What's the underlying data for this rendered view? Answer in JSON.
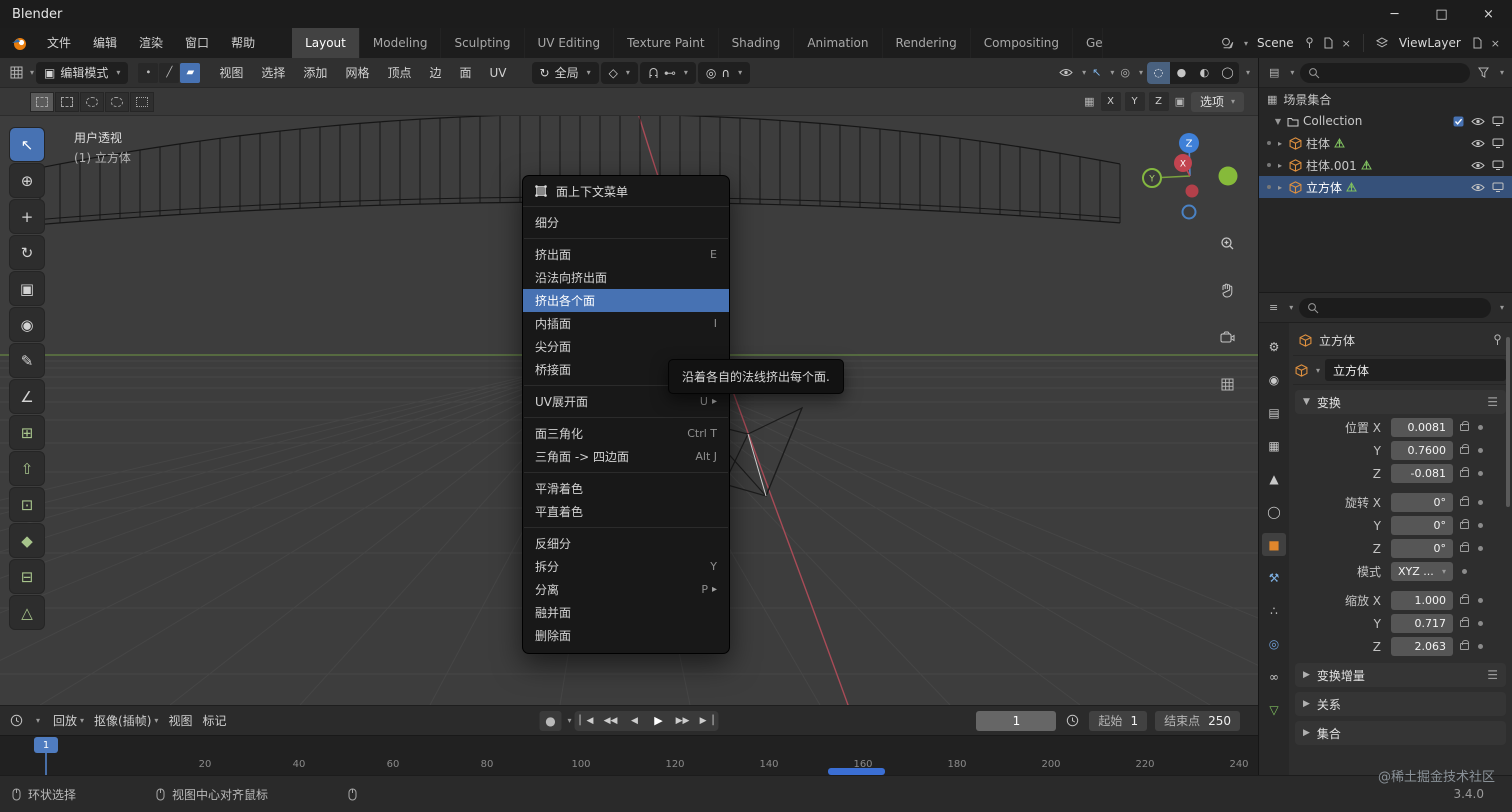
{
  "titlebar": {
    "app_title": "Blender"
  },
  "menubar": {
    "menus": [
      "文件",
      "编辑",
      "渲染",
      "窗口",
      "帮助"
    ],
    "workspaces": [
      "Layout",
      "Modeling",
      "Sculpting",
      "UV Editing",
      "Texture Paint",
      "Shading",
      "Animation",
      "Rendering",
      "Compositing",
      "Ge"
    ],
    "active_workspace": "Layout",
    "scene_name": "Scene",
    "viewlayer_name": "ViewLayer"
  },
  "header": {
    "mode_select": "编辑模式",
    "menus": [
      "视图",
      "选择",
      "添加",
      "网格",
      "顶点",
      "边",
      "面",
      "UV"
    ],
    "orientation": "全局",
    "mirror_axes": [
      "X",
      "Y",
      "Z"
    ],
    "options_label": "选项"
  },
  "viewport": {
    "view_name": "用户透视",
    "active_object": "(1) 立方体",
    "gizmo_axes": [
      "X",
      "Y",
      "Z"
    ],
    "nav_buttons": [
      "zoom-in",
      "pan-hand",
      "camera-view",
      "toggle-grid"
    ]
  },
  "toolbar_tools": [
    "tweak-select",
    "cursor",
    "move",
    "rotate",
    "scale",
    "transform",
    "annotate",
    "measure",
    "add-cube",
    "extrude-region",
    "inset-faces",
    "bevel",
    "loop-cut",
    "knife"
  ],
  "context_menu": {
    "title": "面上下文菜单",
    "items": [
      {
        "label": "细分",
        "shortcut": "",
        "sep_after": true
      },
      {
        "label": "挤出面",
        "shortcut": "E"
      },
      {
        "label": "沿法向挤出面",
        "shortcut": ""
      },
      {
        "label": "挤出各个面",
        "shortcut": "",
        "highlighted": true
      },
      {
        "label": "内插面",
        "shortcut": "I"
      },
      {
        "label": "尖分面",
        "shortcut": ""
      },
      {
        "label": "桥接面",
        "shortcut": "",
        "sep_after": true
      },
      {
        "label": "UV展开面",
        "shortcut": "U",
        "submenu": true,
        "sep_after": true
      },
      {
        "label": "面三角化",
        "shortcut": "Ctrl T"
      },
      {
        "label": "三角面 -> 四边面",
        "shortcut": "Alt J",
        "sep_after": true
      },
      {
        "label": "平滑着色",
        "shortcut": ""
      },
      {
        "label": "平直着色",
        "shortcut": "",
        "sep_after": true
      },
      {
        "label": "反细分",
        "shortcut": ""
      },
      {
        "label": "拆分",
        "shortcut": "Y"
      },
      {
        "label": "分离",
        "shortcut": "P",
        "submenu": true
      },
      {
        "label": "融并面",
        "shortcut": ""
      },
      {
        "label": "删除面",
        "shortcut": ""
      }
    ]
  },
  "tooltip": {
    "text": "沿着各自的法线挤出每个面."
  },
  "outliner": {
    "scene_collection": "场景集合",
    "rows": [
      {
        "label": "Collection",
        "type": "collection"
      },
      {
        "label": "柱体",
        "type": "mesh"
      },
      {
        "label": "柱体.001",
        "type": "mesh"
      },
      {
        "label": "立方体",
        "type": "mesh",
        "selected": true
      }
    ]
  },
  "properties": {
    "tab_icons": [
      "tool",
      "render",
      "output",
      "view-layer",
      "scene",
      "world",
      "object",
      "modifiers",
      "particles",
      "physics",
      "constraints",
      "object-data"
    ],
    "active_tab": "object",
    "breadcrumb_object": "立方体",
    "object_name": "立方体",
    "sections": {
      "transform": "变换",
      "delta": "变换增量",
      "relations": "关系",
      "collections": "集合"
    },
    "transform_rows": [
      {
        "label": "位置 X",
        "value": "0.0081",
        "lock": true
      },
      {
        "label": "Y",
        "value": "0.7600",
        "lock": true
      },
      {
        "label": "Z",
        "value": "-0.081",
        "lock": true
      },
      {
        "label": "旋转 X",
        "value": "0°",
        "lock": true,
        "gap_before": true
      },
      {
        "label": "Y",
        "value": "0°",
        "lock": true
      },
      {
        "label": "Z",
        "value": "0°",
        "lock": true
      },
      {
        "label": "模式",
        "value": "XYZ ...",
        "dropdown": true
      },
      {
        "label": "缩放 X",
        "value": "1.000",
        "lock": true,
        "gap_before": true
      },
      {
        "label": "Y",
        "value": "0.717",
        "lock": true
      },
      {
        "label": "Z",
        "value": "2.063",
        "lock": true
      }
    ]
  },
  "timeline": {
    "menus": [
      "回放",
      "抠像(插帧)",
      "视图",
      "标记"
    ],
    "current_frame": "1",
    "start_label": "起始",
    "start_value": "1",
    "end_label": "结束点",
    "end_value": "250",
    "ruler_ticks": [
      "20",
      "40",
      "60",
      "80",
      "100",
      "120",
      "140",
      "160",
      "180",
      "200",
      "220",
      "240"
    ],
    "playhead_frame": "1"
  },
  "statusbar": {
    "hints": [
      "环状选择",
      "视图中心对齐鼠标"
    ],
    "version": "3.4.0"
  },
  "watermark": "@稀土掘金技术社区",
  "colors": {
    "accent": "#4772b3",
    "selection": "#36517a"
  }
}
